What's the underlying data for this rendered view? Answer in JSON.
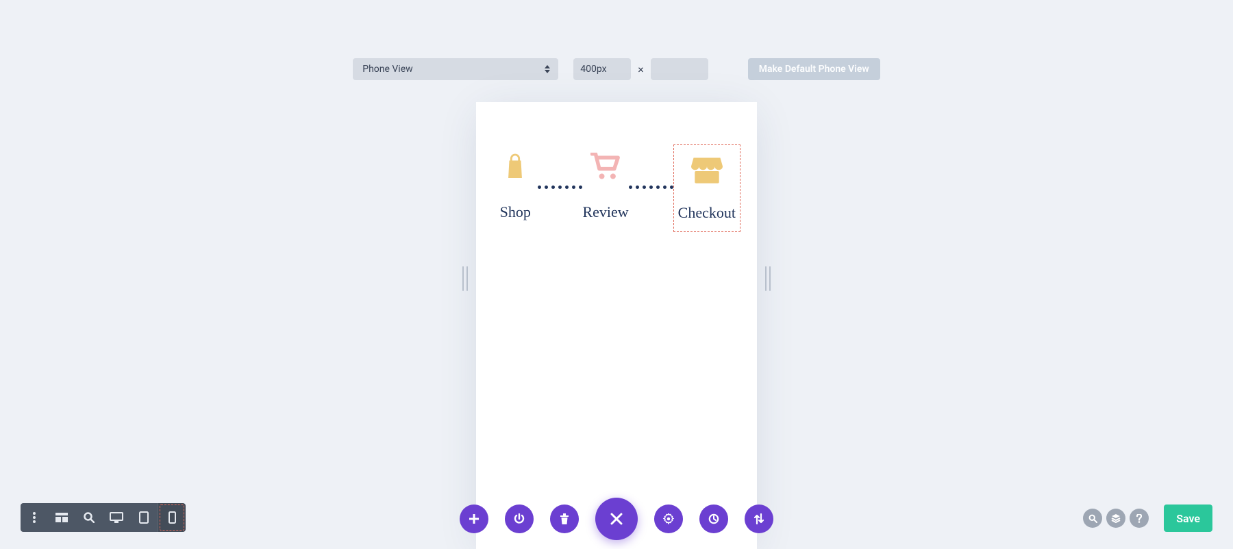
{
  "top": {
    "view_select": "Phone View",
    "width_value": "400px",
    "height_value": "",
    "default_button": "Make Default Phone View"
  },
  "canvas": {
    "blurbs": {
      "shop": {
        "label": "Shop"
      },
      "review": {
        "label": "Review"
      },
      "checkout": {
        "label": "Checkout"
      }
    }
  },
  "right": {
    "save": "Save"
  }
}
